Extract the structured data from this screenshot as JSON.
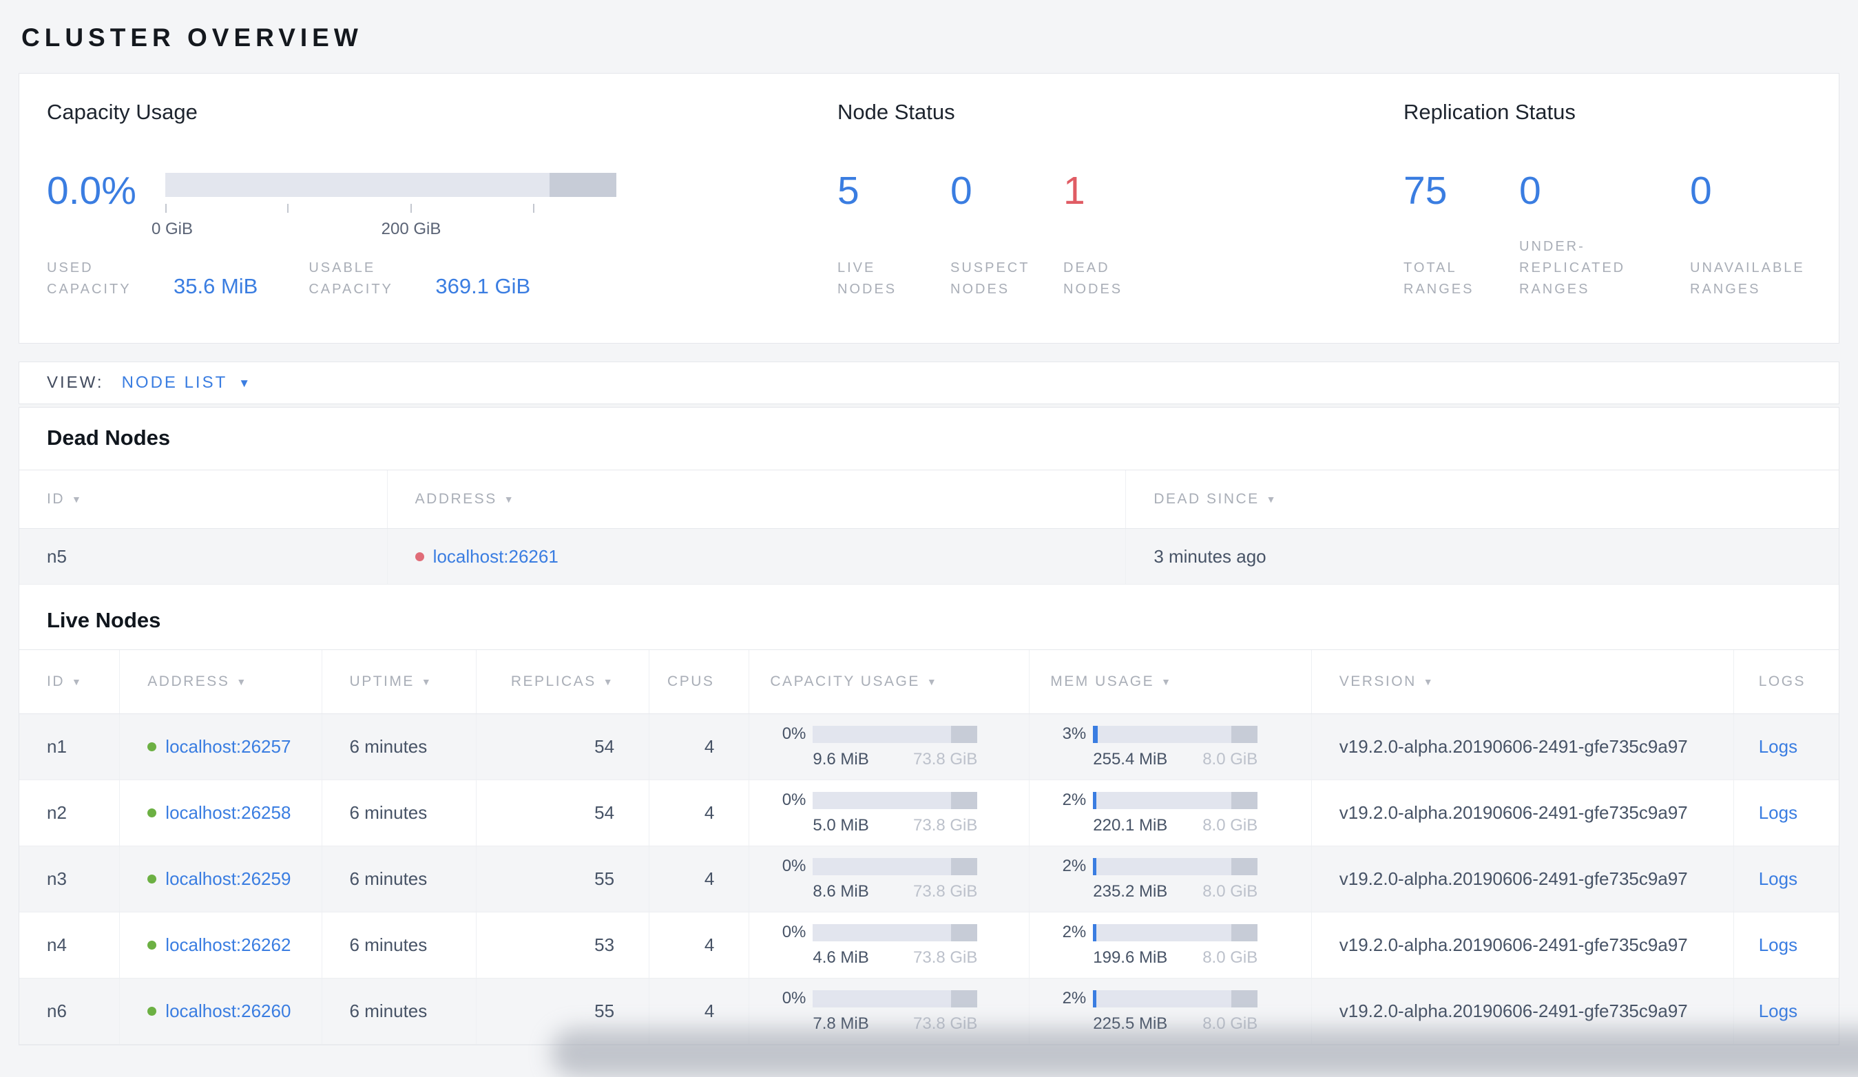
{
  "page_title": "CLUSTER OVERVIEW",
  "icons": {
    "sort_arrow": "▼",
    "dropdown_caret": "▼"
  },
  "colors": {
    "accent_blue": "#3a7de1",
    "dead_red": "#e05c64",
    "live_dot_green": "#6cb043",
    "dead_dot_red": "#e06c78",
    "label_gray": "#a9aeb7"
  },
  "summary": {
    "capacity": {
      "title": "Capacity Usage",
      "percent": "0.0%",
      "tick_labels": {
        "t0": "0 GiB",
        "t2": "200 GiB"
      },
      "used_label": "USED CAPACITY",
      "used_value": "35.6 MiB",
      "usable_label": "USABLE CAPACITY",
      "usable_value": "369.1 GiB"
    },
    "node_status": {
      "title": "Node Status",
      "live": {
        "value": "5",
        "label": "LIVE NODES"
      },
      "suspect": {
        "value": "0",
        "label": "SUSPECT NODES"
      },
      "dead": {
        "value": "1",
        "label": "DEAD NODES"
      }
    },
    "replication": {
      "title": "Replication Status",
      "total": {
        "value": "75",
        "label": "TOTAL RANGES"
      },
      "under_replicated": {
        "value": "0",
        "label": "UNDER-REPLICATED RANGES"
      },
      "unavailable": {
        "value": "0",
        "label": "UNAVAILABLE RANGES"
      }
    }
  },
  "view_bar": {
    "label": "VIEW:",
    "selected": "NODE LIST"
  },
  "dead_nodes": {
    "title": "Dead Nodes",
    "columns": {
      "id": "ID",
      "address": "ADDRESS",
      "dead_since": "DEAD SINCE"
    },
    "rows": [
      {
        "id": "n5",
        "address": "localhost:26261",
        "dead_since": "3 minutes ago"
      }
    ]
  },
  "live_nodes": {
    "title": "Live Nodes",
    "columns": {
      "id": "ID",
      "address": "ADDRESS",
      "uptime": "UPTIME",
      "replicas": "REPLICAS",
      "cpus": "CPUS",
      "capacity": "CAPACITY USAGE",
      "mem": "MEM USAGE",
      "version": "VERSION",
      "logs": "LOGS"
    },
    "rows": [
      {
        "id": "n1",
        "address": "localhost:26257",
        "uptime": "6 minutes",
        "replicas": "54",
        "cpus": "4",
        "capacity_pct": "0%",
        "capacity_used": "9.6 MiB",
        "capacity_total": "73.8 GiB",
        "mem_pct": "3%",
        "mem_used": "255.4 MiB",
        "mem_total": "8.0 GiB",
        "version": "v19.2.0-alpha.20190606-2491-gfe735c9a97",
        "logs": "Logs"
      },
      {
        "id": "n2",
        "address": "localhost:26258",
        "uptime": "6 minutes",
        "replicas": "54",
        "cpus": "4",
        "capacity_pct": "0%",
        "capacity_used": "5.0 MiB",
        "capacity_total": "73.8 GiB",
        "mem_pct": "2%",
        "mem_used": "220.1 MiB",
        "mem_total": "8.0 GiB",
        "version": "v19.2.0-alpha.20190606-2491-gfe735c9a97",
        "logs": "Logs"
      },
      {
        "id": "n3",
        "address": "localhost:26259",
        "uptime": "6 minutes",
        "replicas": "55",
        "cpus": "4",
        "capacity_pct": "0%",
        "capacity_used": "8.6 MiB",
        "capacity_total": "73.8 GiB",
        "mem_pct": "2%",
        "mem_used": "235.2 MiB",
        "mem_total": "8.0 GiB",
        "version": "v19.2.0-alpha.20190606-2491-gfe735c9a97",
        "logs": "Logs"
      },
      {
        "id": "n4",
        "address": "localhost:26262",
        "uptime": "6 minutes",
        "replicas": "53",
        "cpus": "4",
        "capacity_pct": "0%",
        "capacity_used": "4.6 MiB",
        "capacity_total": "73.8 GiB",
        "mem_pct": "2%",
        "mem_used": "199.6 MiB",
        "mem_total": "8.0 GiB",
        "version": "v19.2.0-alpha.20190606-2491-gfe735c9a97",
        "logs": "Logs"
      },
      {
        "id": "n6",
        "address": "localhost:26260",
        "uptime": "6 minutes",
        "replicas": "55",
        "cpus": "4",
        "capacity_pct": "0%",
        "capacity_used": "7.8 MiB",
        "capacity_total": "73.8 GiB",
        "mem_pct": "2%",
        "mem_used": "225.5 MiB",
        "mem_total": "8.0 GiB",
        "version": "v19.2.0-alpha.20190606-2491-gfe735c9a97",
        "logs": "Logs"
      }
    ]
  }
}
